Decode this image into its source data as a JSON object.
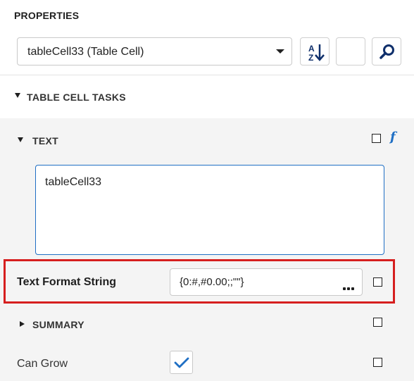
{
  "panel": {
    "title": "PROPERTIES"
  },
  "selector": {
    "value": "tableCell33 (Table Cell)",
    "icon": "chevron-down-icon"
  },
  "toolbar": {
    "sort_icon": "sort-alphabetical-icon",
    "blank_icon": "",
    "search_icon": "search-icon"
  },
  "tasks": {
    "label": "TABLE CELL TASKS"
  },
  "text_section": {
    "label": "TEXT",
    "expression_icon": "f",
    "value": "tableCell33"
  },
  "format": {
    "label": "Text Format String",
    "value": "{0:#,#0.00;;\"\"}",
    "ellipsis_icon": "ellipsis-icon"
  },
  "summary": {
    "label": "SUMMARY"
  },
  "can_grow": {
    "label": "Can Grow",
    "checked": true
  },
  "colors": {
    "accent": "#1f6fc4",
    "highlight": "#d61f1f",
    "body_bg": "#f4f4f4"
  }
}
